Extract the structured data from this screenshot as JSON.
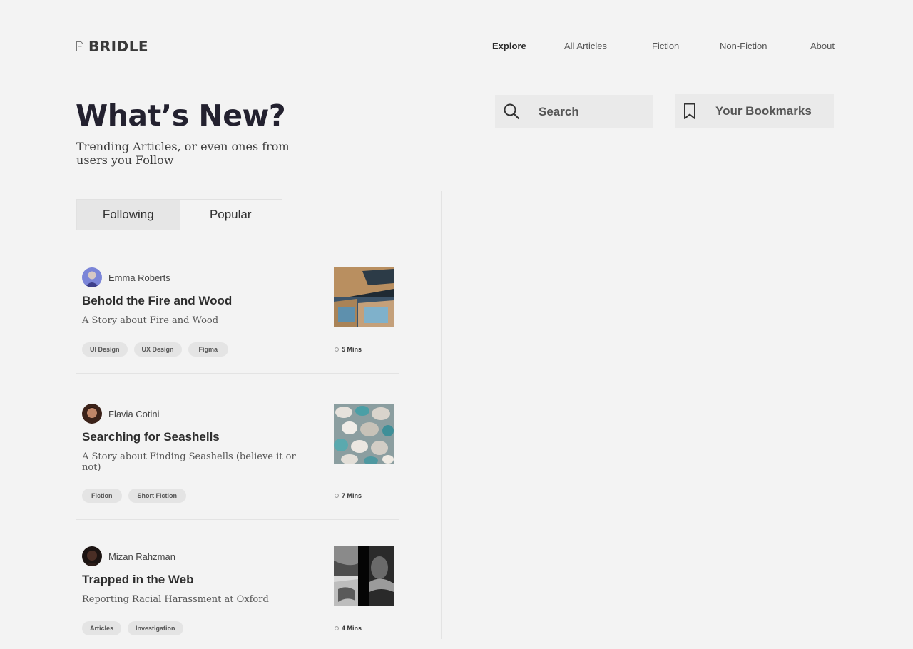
{
  "brand": {
    "name": "BRIDLE",
    "icon": "document-icon"
  },
  "nav": {
    "items": [
      {
        "label": "Explore",
        "active": true
      },
      {
        "label": "All Articles",
        "active": false
      },
      {
        "label": "Fiction",
        "active": false
      },
      {
        "label": "Non-Fiction",
        "active": false
      },
      {
        "label": "About",
        "active": false
      }
    ]
  },
  "hero": {
    "title": "What’s New?",
    "subtitle": "Trending Articles, or even ones from users you Follow"
  },
  "search": {
    "label": "Search",
    "icon": "search-icon"
  },
  "bookmarks": {
    "label": "Your Bookmarks",
    "icon": "bookmark-icon"
  },
  "tabs": [
    {
      "label": "Following",
      "active": true
    },
    {
      "label": "Popular",
      "active": false
    }
  ],
  "articles": [
    {
      "author": "Emma Roberts",
      "title": "Behold the Fire and Wood",
      "description": "A Story about Fire and Wood",
      "tags": [
        "UI Design",
        "UX Design",
        "Figma"
      ],
      "read_time": "5 Mins"
    },
    {
      "author": "Flavia Cotini",
      "title": "Searching for Seashells",
      "description": "A Story about Finding Seashells (believe it or not)",
      "tags": [
        "Fiction",
        "Short Fiction"
      ],
      "read_time": "7 Mins"
    },
    {
      "author": "Mizan Rahzman",
      "title": "Trapped in the Web",
      "description": "Reporting Racial Harassment at Oxford",
      "tags": [
        "Articles",
        "Investigation"
      ],
      "read_time": "4 Mins"
    }
  ],
  "colors": {
    "background": "#f3f3f3",
    "heading": "#23212f",
    "panel": "#eaeaea"
  }
}
